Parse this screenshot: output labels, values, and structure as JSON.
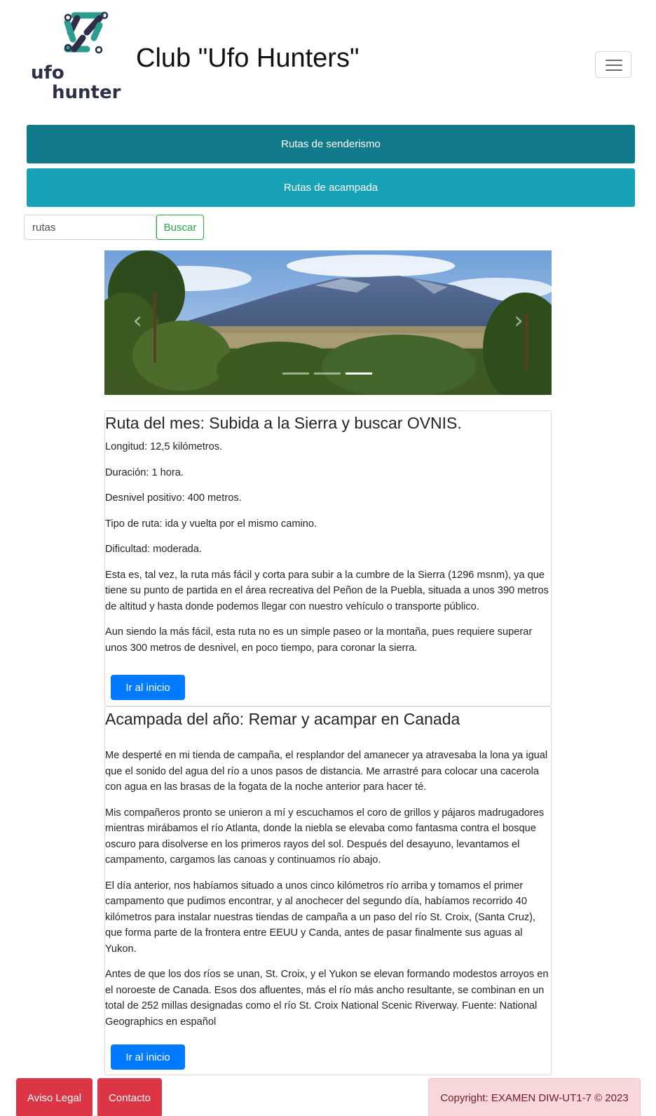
{
  "header": {
    "logo_text_line1": "ufo",
    "logo_text_line2": "hunter",
    "title": "Club \"Ufo Hunters\"",
    "menu_icon": "hamburger-icon"
  },
  "nav": {
    "hiking": "Rutas de senderismo",
    "camping": "Rutas de acampada"
  },
  "search": {
    "value": "rutas",
    "button": "Buscar"
  },
  "carousel": {
    "prev_icon": "chevron-left-icon",
    "next_icon": "chevron-right-icon",
    "prev_glyph": "‹",
    "next_glyph": "›",
    "slide_count": 3,
    "active_slide": 3
  },
  "card1": {
    "title": "Ruta del mes: Subida a la Sierra y buscar OVNIS.",
    "facts": [
      "Longitud: 12,5 kilómetros.",
      "Duración: 1 hora.",
      "Desnivel positivo: 400 metros.",
      "Tipo de ruta: ida y vuelta por el mismo camino.",
      "Dificultad: moderada."
    ],
    "paragraphs": [
      "Esta es, tal vez, la ruta más fácil y corta para subir a la cumbre de la Sierra (1296 msnm), ya que tiene su punto de partida en el área recreativa del Peñon de la Puebla, situada a unos 390 metros de altitud y hasta donde podemos llegar con nuestro vehículo o transporte público.",
      "Aun siendo la más fácil, esta ruta no es un simple paseo or la montaña, pues requiere superar unos 300 metros de desnivel, en poco tiempo, para coronar la sierra."
    ],
    "button": "Ir al inicio"
  },
  "card2": {
    "title": "Acampada del año: Remar y acampar en Canada",
    "paragraphs": [
      "Me desperté en mi tienda de campaña, el resplandor del amanecer ya atravesaba la lona ya igual que el sonido del agua del río a unos pasos de distancia. Me arrastré para colocar una cacerola con agua en las brasas de la fogata de la noche anterior para hacer té.",
      "Mis compañeros pronto se unieron a mí y escuchamos el coro de grillos y pájaros madrugadores mientras mirábamos el río Atlanta, donde la niebla se elevaba como fantasma contra el bosque oscuro para disolverse en los primeros rayos del sol. Después del desayuno, levantamos el campamento, cargamos las canoas y continuamos río abajo.",
      "El día anterior, nos habíamos situado a unos cinco kilómetros río arriba y tomamos el primer campamento que pudimos encontrar, y al anochecer del segundo día, habíamos recorrido 40 kilómetros para instalar nuestras tiendas de campaña a un paso del río St. Croix, (Santa Cruz), que forma parte de la frontera entre EEUU y Canda, antes de pasar finalmente sus aguas al Yukon.",
      "Antes de que los dos ríos se unan, St. Croix, y el Yukon se elevan formando modestos arroyos en el noroeste de Canada. Esos dos afluentes, más el río más ancho resultante, se combinan en un total de 252 millas designadas como el río St. Croix National Scenic Riverway. Fuente: National Geographics en español"
    ],
    "button": "Ir al inicio"
  },
  "footer": {
    "legal": "Aviso Legal",
    "contact": "Contacto",
    "copyright": "Copyright: EXAMEN DIW-UT1-7 © 2023"
  },
  "colors": {
    "nav_dark": "#117a8b",
    "nav_light": "#17a2b8",
    "search_green": "#28a745",
    "primary": "#007bff",
    "danger": "#dc3545",
    "alert_bg": "#f8d7da"
  }
}
